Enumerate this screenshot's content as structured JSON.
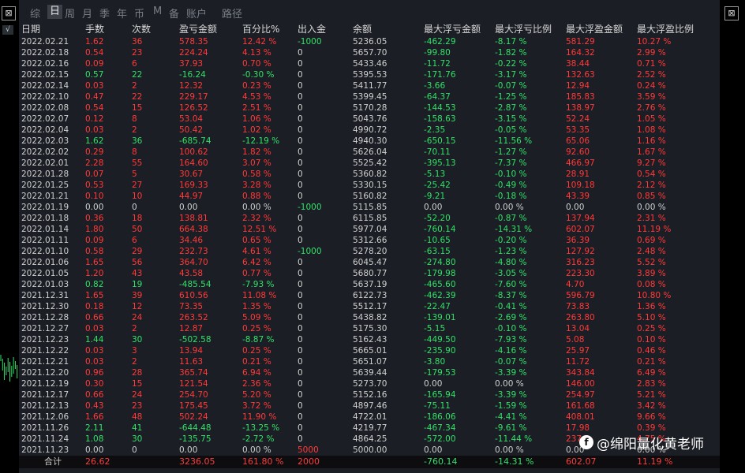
{
  "tabs": [
    "综",
    "日",
    "周",
    "月",
    "季",
    "年",
    "币",
    "M",
    "备",
    "账户",
    "路径"
  ],
  "active_tab": "日",
  "columns": [
    "日期",
    "手数",
    "次数",
    "盈亏金额",
    "百分比%",
    "出入金",
    "余额",
    "最大浮亏金额",
    "最大浮亏比例",
    "最大浮盈金额",
    "最大浮盈比例"
  ],
  "rows": [
    [
      "2022.02.21",
      "1.62",
      "36",
      "578.35",
      "12.42 %",
      "-1000",
      "5236.05",
      "-462.29",
      "-8.17 %",
      "581.29",
      "10.27 %"
    ],
    [
      "2022.02.18",
      "0.54",
      "23",
      "224.24",
      "4.13 %",
      "0",
      "5657.70",
      "-99.80",
      "-1.82 %",
      "164.32",
      "2.99 %"
    ],
    [
      "2022.02.16",
      "0.09",
      "6",
      "37.93",
      "0.70 %",
      "0",
      "5433.46",
      "-11.72",
      "-0.22 %",
      "38.44",
      "0.71 %"
    ],
    [
      "2022.02.15",
      "0.57",
      "22",
      "-16.24",
      "-0.30 %",
      "0",
      "5395.53",
      "-171.76",
      "-3.17 %",
      "132.63",
      "2.52 %"
    ],
    [
      "2022.02.14",
      "0.03",
      "2",
      "12.32",
      "0.23 %",
      "0",
      "5411.77",
      "-3.66",
      "-0.07 %",
      "12.94",
      "0.24 %"
    ],
    [
      "2022.02.10",
      "0.47",
      "22",
      "229.17",
      "4.53 %",
      "0",
      "5399.45",
      "-64.37",
      "-1.25 %",
      "185.83",
      "3.59 %"
    ],
    [
      "2022.02.08",
      "0.54",
      "15",
      "126.52",
      "2.51 %",
      "0",
      "5170.28",
      "-144.53",
      "-2.87 %",
      "138.97",
      "2.76 %"
    ],
    [
      "2022.02.07",
      "0.12",
      "8",
      "53.04",
      "1.06 %",
      "0",
      "5043.76",
      "-158.63",
      "-3.15 %",
      "52.24",
      "1.05 %"
    ],
    [
      "2022.02.04",
      "0.03",
      "2",
      "50.42",
      "1.02 %",
      "0",
      "4990.72",
      "-2.35",
      "-0.05 %",
      "53.35",
      "1.08 %"
    ],
    [
      "2022.02.03",
      "1.62",
      "36",
      "-685.74",
      "-12.19 %",
      "0",
      "4940.30",
      "-650.15",
      "-11.56 %",
      "65.06",
      "1.16 %"
    ],
    [
      "2022.02.02",
      "0.29",
      "8",
      "100.62",
      "1.82 %",
      "0",
      "5626.04",
      "-70.11",
      "-1.27 %",
      "92.60",
      "1.67 %"
    ],
    [
      "2022.02.01",
      "2.28",
      "55",
      "164.60",
      "3.07 %",
      "0",
      "5525.42",
      "-395.13",
      "-7.37 %",
      "466.97",
      "9.27 %"
    ],
    [
      "2022.01.28",
      "0.07",
      "5",
      "30.67",
      "0.58 %",
      "0",
      "5360.82",
      "-5.13",
      "-0.10 %",
      "28.91",
      "0.54 %"
    ],
    [
      "2022.01.25",
      "0.53",
      "27",
      "169.33",
      "3.28 %",
      "0",
      "5330.15",
      "-25.42",
      "-0.49 %",
      "109.18",
      "2.12 %"
    ],
    [
      "2022.01.21",
      "0.10",
      "10",
      "44.97",
      "0.88 %",
      "0",
      "5160.82",
      "-9.21",
      "-0.18 %",
      "43.39",
      "0.85 %"
    ],
    [
      "2022.01.19",
      "0.00",
      "0",
      "0.00",
      "0.00 %",
      "-1000",
      "5115.85",
      "0.00",
      "0.00 %",
      "0.00",
      "0.00 %"
    ],
    [
      "2022.01.18",
      "0.36",
      "18",
      "138.81",
      "2.32 %",
      "0",
      "6115.85",
      "-52.20",
      "-0.87 %",
      "137.94",
      "2.31 %"
    ],
    [
      "2022.01.14",
      "1.80",
      "50",
      "664.38",
      "12.51 %",
      "0",
      "5977.04",
      "-760.14",
      "-14.31 %",
      "602.07",
      "11.19 %"
    ],
    [
      "2022.01.11",
      "0.09",
      "6",
      "34.46",
      "0.65 %",
      "0",
      "5312.66",
      "-10.65",
      "-0.20 %",
      "36.39",
      "0.69 %"
    ],
    [
      "2022.01.10",
      "0.58",
      "29",
      "232.73",
      "4.61 %",
      "-1000",
      "5278.20",
      "-63.15",
      "-1.23 %",
      "127.92",
      "2.48 %"
    ],
    [
      "2022.01.06",
      "1.65",
      "56",
      "364.70",
      "6.42 %",
      "0",
      "6045.47",
      "-274.80",
      "-4.80 %",
      "316.23",
      "5.52 %"
    ],
    [
      "2022.01.05",
      "1.20",
      "43",
      "43.58",
      "0.77 %",
      "0",
      "5680.77",
      "-179.98",
      "-3.05 %",
      "223.30",
      "3.89 %"
    ],
    [
      "2022.01.03",
      "0.82",
      "19",
      "-485.54",
      "-7.93 %",
      "0",
      "5637.19",
      "-465.60",
      "-7.60 %",
      "4.70",
      "0.08 %"
    ],
    [
      "2021.12.31",
      "1.65",
      "39",
      "610.56",
      "11.08 %",
      "0",
      "6122.73",
      "-462.39",
      "-8.37 %",
      "596.79",
      "10.80 %"
    ],
    [
      "2021.12.30",
      "0.18",
      "12",
      "73.35",
      "1.35 %",
      "0",
      "5512.17",
      "-22.47",
      "-0.41 %",
      "73.83",
      "1.36 %"
    ],
    [
      "2021.12.28",
      "0.66",
      "24",
      "263.52",
      "5.09 %",
      "0",
      "5438.82",
      "-139.01",
      "-2.69 %",
      "263.80",
      "5.10 %"
    ],
    [
      "2021.12.27",
      "0.03",
      "2",
      "12.87",
      "0.25 %",
      "0",
      "5175.30",
      "-5.15",
      "-0.10 %",
      "13.04",
      "0.25 %"
    ],
    [
      "2021.12.23",
      "1.44",
      "30",
      "-502.58",
      "-8.87 %",
      "0",
      "5162.43",
      "-449.50",
      "-7.93 %",
      "5.08",
      "0.10 %"
    ],
    [
      "2021.12.22",
      "0.03",
      "3",
      "13.94",
      "0.25 %",
      "0",
      "5665.01",
      "-235.90",
      "-4.16 %",
      "25.97",
      "0.46 %"
    ],
    [
      "2021.12.21",
      "0.03",
      "2",
      "11.63",
      "0.21 %",
      "0",
      "5651.07",
      "-3.80",
      "-0.07 %",
      "11.72",
      "0.21 %"
    ],
    [
      "2021.12.20",
      "0.96",
      "28",
      "365.74",
      "6.94 %",
      "0",
      "5639.44",
      "-179.53",
      "-3.39 %",
      "343.84",
      "6.49 %"
    ],
    [
      "2021.12.19",
      "0.30",
      "15",
      "121.54",
      "2.36 %",
      "0",
      "5273.70",
      "0.00",
      "0.00 %",
      "146.00",
      "2.83 %"
    ],
    [
      "2021.12.17",
      "0.66",
      "24",
      "254.70",
      "5.20 %",
      "0",
      "5152.16",
      "-165.94",
      "-3.39 %",
      "254.97",
      "5.21 %"
    ],
    [
      "2021.12.13",
      "0.43",
      "23",
      "175.45",
      "3.72 %",
      "0",
      "4897.46",
      "-75.11",
      "-1.59 %",
      "161.68",
      "3.42 %"
    ],
    [
      "2021.12.06",
      "1.66",
      "48",
      "502.24",
      "11.90 %",
      "0",
      "4722.01",
      "-186.06",
      "-4.41 %",
      "408.01",
      "9.66 %"
    ],
    [
      "2021.11.26",
      "2.11",
      "41",
      "-644.48",
      "-13.25 %",
      "0",
      "4219.77",
      "-467.34",
      "-9.61 %",
      "17.98",
      "0.39 %"
    ],
    [
      "2021.11.24",
      "1.08",
      "30",
      "-135.75",
      "-2.72 %",
      "0",
      "4864.25",
      "-572.00",
      "-11.44 %",
      "237",
      "4.75 %"
    ],
    [
      "2021.11.23",
      "0.00",
      "0",
      "0.00",
      "0.00 %",
      "5000",
      "5000.00",
      "0.00",
      "0.00 %",
      "0.00",
      "0.00 %"
    ]
  ],
  "total": [
    "合计",
    "26.62",
    "",
    "3236.05",
    "161.80 %",
    "2000",
    "",
    "-760.14",
    "-14.31 %",
    "602.07",
    "11.19 %"
  ],
  "watermark": {
    "logo": "f",
    "text": "@绵阳量化黄老师"
  },
  "left_icons": {
    "grab": "drag-handle-icon",
    "check": "checkmark-icon",
    "check_glyph": "√"
  },
  "colors": {
    "profit": "#ff3b3b",
    "loss": "#33e06a",
    "neutral": "#d0d0d0",
    "panel_bg": "#1b1e24"
  }
}
